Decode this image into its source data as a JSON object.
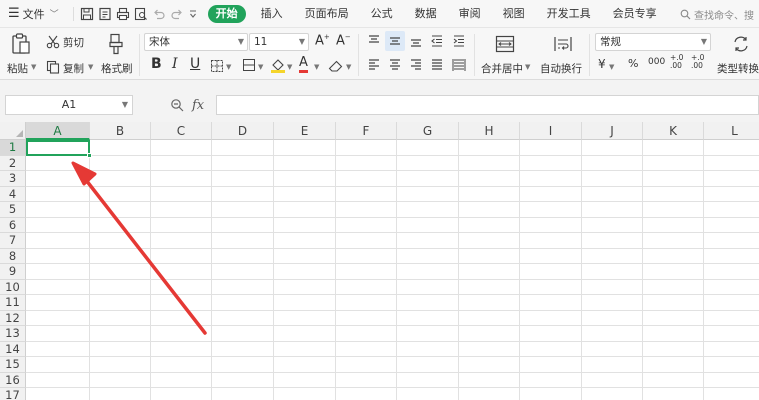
{
  "menu": {
    "file_label": "文件",
    "tabs": [
      "开始",
      "插入",
      "页面布局",
      "公式",
      "数据",
      "审阅",
      "视图",
      "开发工具",
      "会员专享"
    ],
    "search_text": "查找命令、搜"
  },
  "ribbon": {
    "paste": "粘贴",
    "cut": "剪切",
    "copy": "复制",
    "format_painter": "格式刷",
    "font_name": "宋体",
    "font_size": "11",
    "merge_center": "合并居中",
    "wrap_text": "自动换行",
    "number_format": "常规",
    "type_convert": "类型转换",
    "pct": "%",
    "thousands": "000",
    "dec_inc": "+.0 .00",
    "dec_dec": "+.0 .00"
  },
  "formula_bar": {
    "name_box": "A1",
    "fx_label": "fx",
    "formula": ""
  },
  "grid": {
    "columns": [
      "A",
      "B",
      "C",
      "D",
      "E",
      "F",
      "G",
      "H",
      "I",
      "J",
      "K",
      "L"
    ],
    "rows": [
      "1",
      "2",
      "3",
      "4",
      "5",
      "6",
      "7",
      "8",
      "9",
      "10",
      "11",
      "12",
      "13",
      "14",
      "15",
      "16",
      "17"
    ],
    "selected_cell": "A1"
  },
  "colors": {
    "accent": "#21a35b",
    "annotation_arrow": "#e53935",
    "toolbar_bg": "#f7f7f7"
  }
}
